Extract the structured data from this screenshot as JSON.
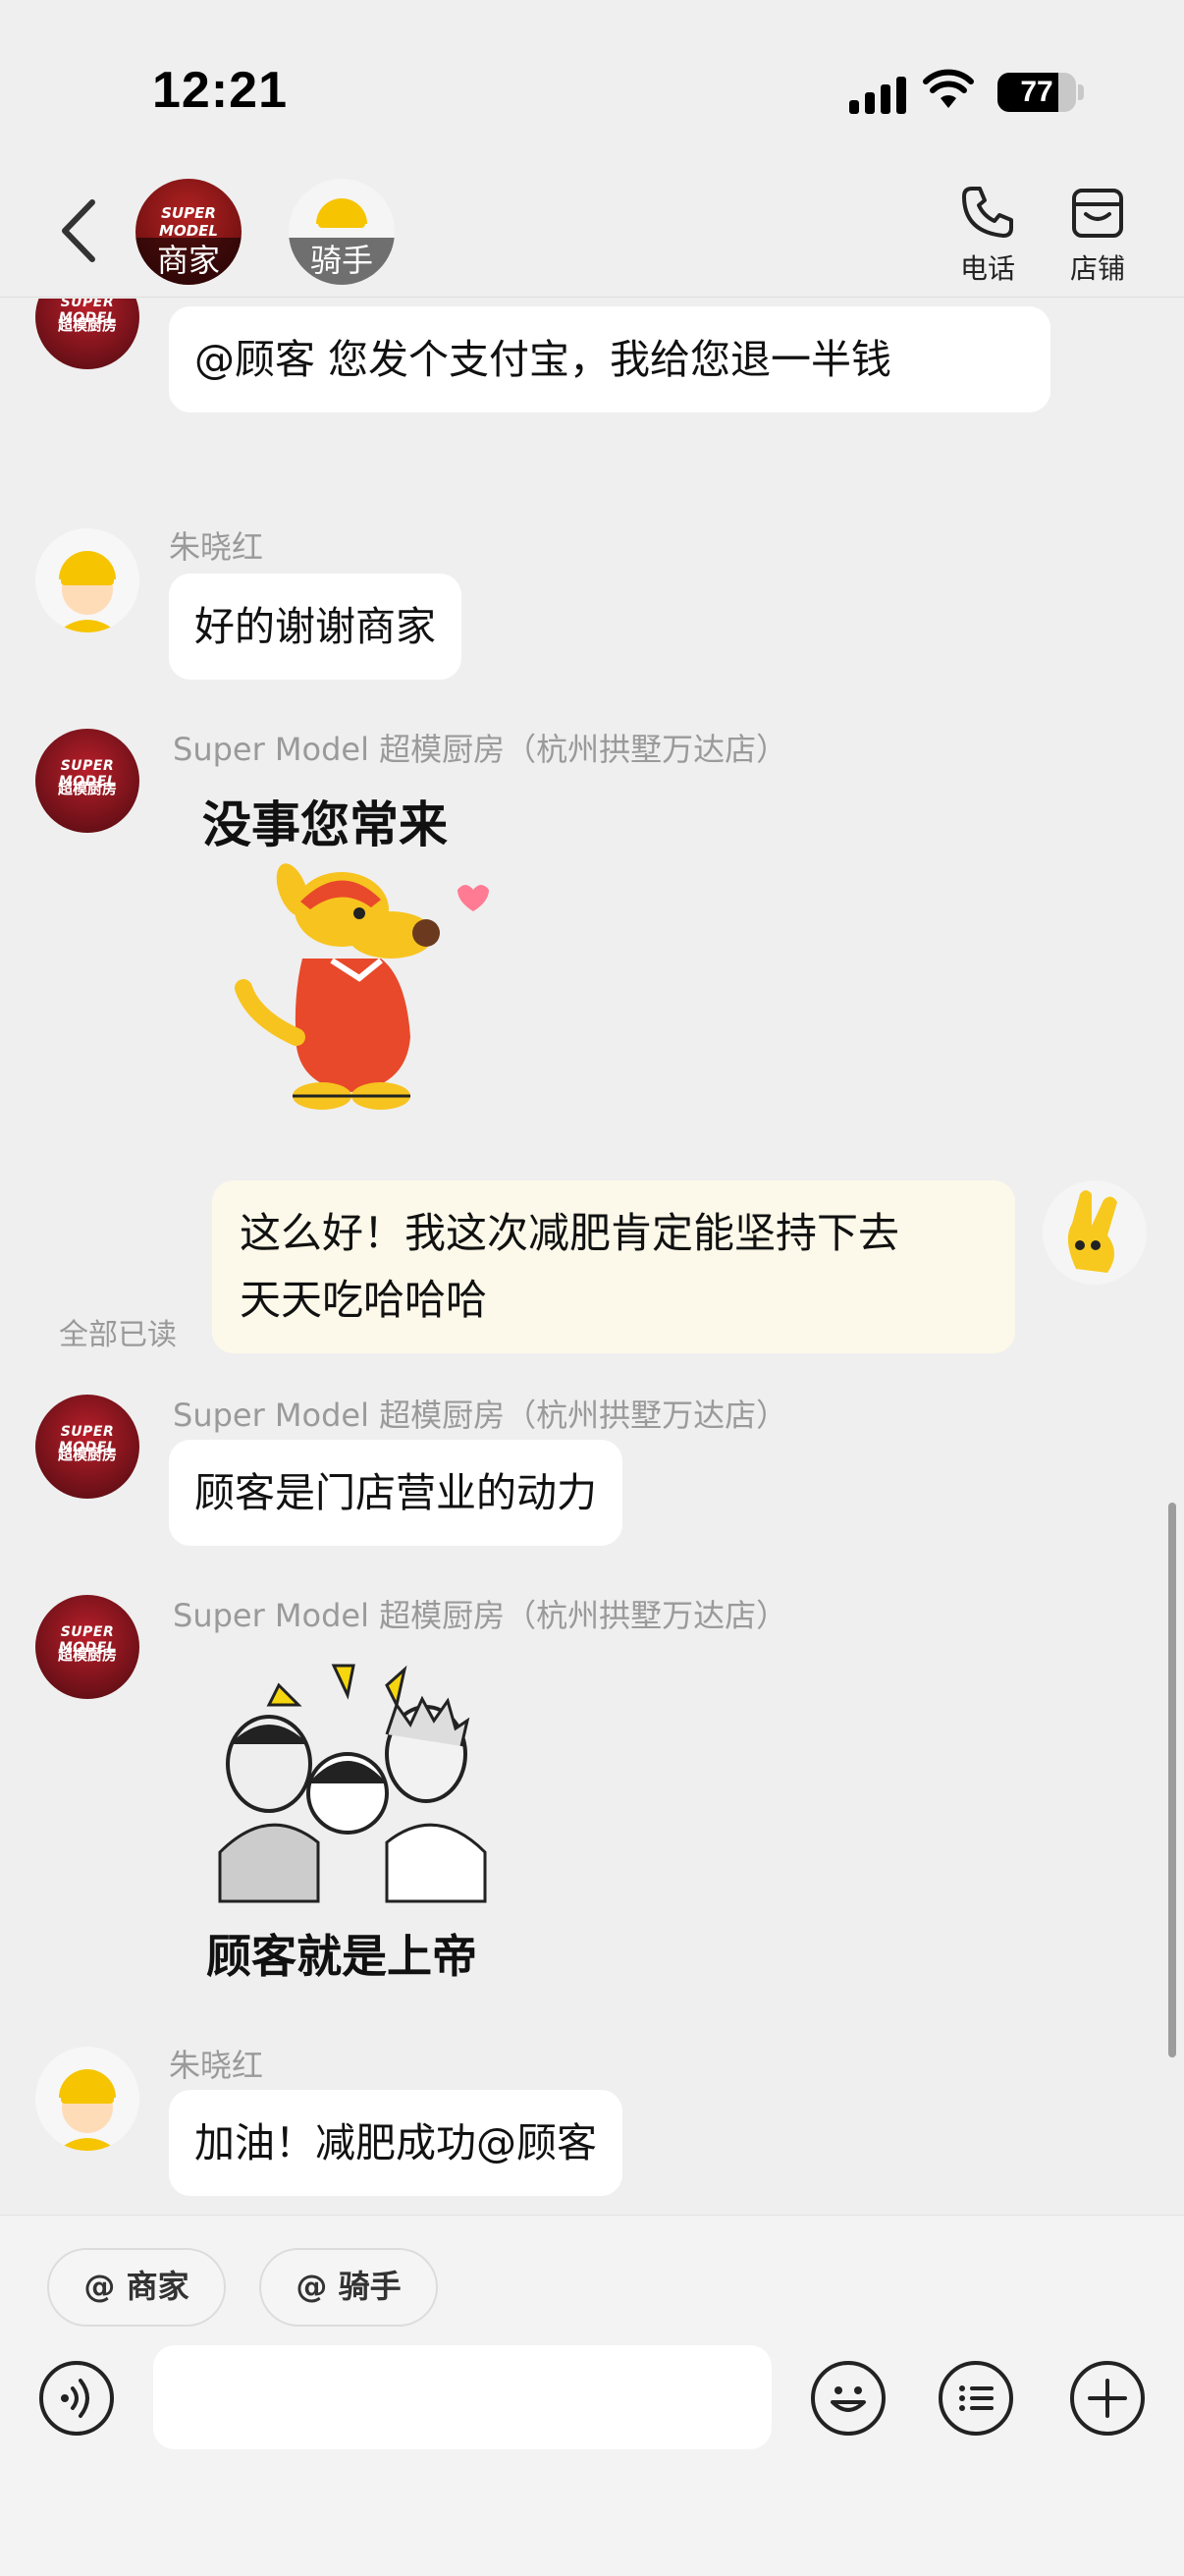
{
  "status_bar": {
    "time": "12:21",
    "battery": "77"
  },
  "header": {
    "merchant_tab": "商家",
    "rider_tab": "骑手",
    "phone_label": "电话",
    "store_label": "店铺"
  },
  "messages": [
    {
      "from": "merchant",
      "text": "@顾客 您发个支付宝，我给您退一半钱"
    },
    {
      "from": "rider",
      "sender": "朱晓红",
      "text": "好的谢谢商家"
    },
    {
      "from": "merchant",
      "sender": "Super Model 超模厨房（杭州拱墅万达店）",
      "sticker_text": "没事您常来",
      "sticker_icon": "kangaroo-sticker"
    },
    {
      "from": "me",
      "status": "全部已读",
      "text_line1": "这么好！我这次减肥肯定能坚持下去",
      "text_line2": "天天吃哈哈哈"
    },
    {
      "from": "merchant",
      "sender": "Super Model 超模厨房（杭州拱墅万达店）",
      "text": "顾客是门店营业的动力"
    },
    {
      "from": "merchant",
      "sender": "Super Model 超模厨房（杭州拱墅万达店）",
      "sticker_text": "顾客就是上帝",
      "sticker_icon": "meme-faces-sticker"
    },
    {
      "from": "rider",
      "sender": "朱晓红",
      "text": "加油！减肥成功@顾客"
    }
  ],
  "avatar_brand": {
    "line1": "SUPER MODEL",
    "line2": "超模厨房"
  },
  "quick_mentions": [
    "@ 商家",
    "@ 骑手"
  ],
  "input": {
    "placeholder": ""
  },
  "colors": {
    "background": "#efefef",
    "bubble": "#ffffff",
    "my_bubble": "#fcf9ea",
    "merchant_avatar": "#8b1520"
  }
}
